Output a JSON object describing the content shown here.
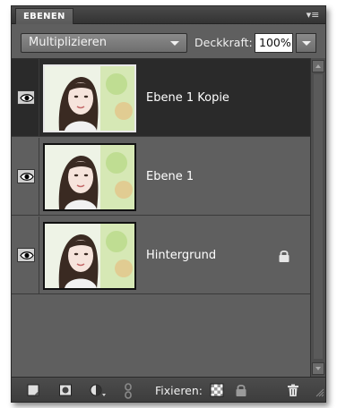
{
  "panel": {
    "tab_label": "EBENEN",
    "menu_icon": "panel-menu-icon"
  },
  "controls": {
    "blend_mode": "Multiplizieren",
    "opacity_label": "Deckkraft:",
    "opacity_value": "100%"
  },
  "layers": [
    {
      "name": "Ebene 1 Kopie",
      "selected": true,
      "locked": false,
      "visible": true
    },
    {
      "name": "Ebene 1",
      "selected": false,
      "locked": false,
      "visible": true
    },
    {
      "name": "Hintergrund",
      "selected": false,
      "locked": true,
      "visible": true
    }
  ],
  "bottombar": {
    "fix_label": "Fixieren:",
    "icons": [
      "new-layer-icon",
      "mask-icon",
      "adjustment-layer-icon",
      "link-icon",
      "lock-transparent-icon",
      "lock-all-icon",
      "trash-icon"
    ]
  },
  "colors": {
    "panel_bg": "#5f5f5f",
    "selected_row": "#2a2a2a",
    "bar_bg": "#3d3d3d"
  }
}
